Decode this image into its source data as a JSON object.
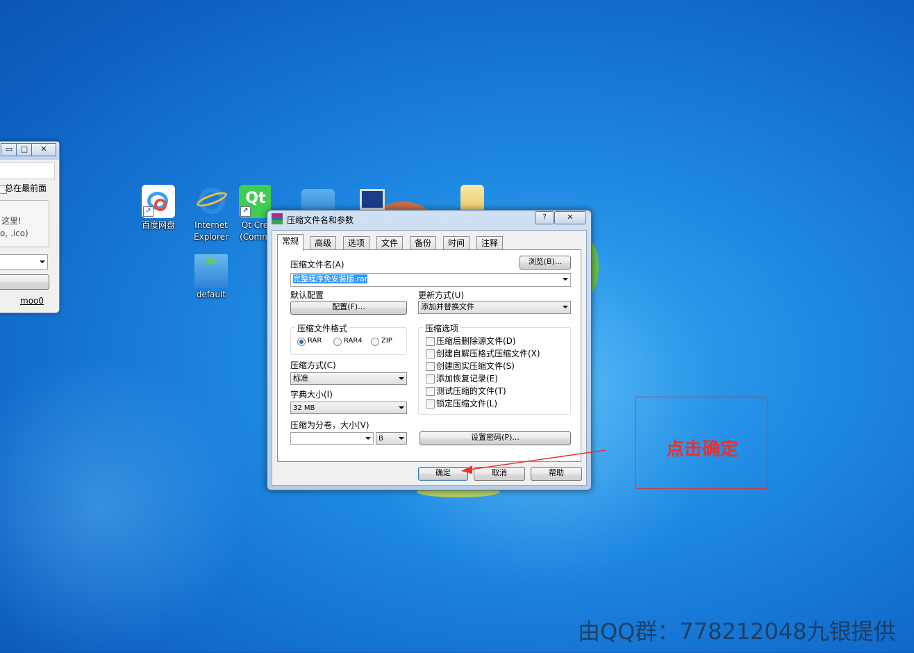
{
  "desktop": {
    "icons": [
      {
        "label": "百度网盘"
      },
      {
        "label": "Internet Explorer"
      },
      {
        "label": "Qt Cre (Comm"
      },
      {
        "label": "default"
      }
    ]
  },
  "left_window": {
    "checkbox_label": "总在最前面",
    "text_line1": "这里!",
    "text_line2": "o, .ico)",
    "link": "moo0"
  },
  "dialog": {
    "title": "压缩文件名和参数",
    "tabs": [
      "常规",
      "高级",
      "选项",
      "文件",
      "备份",
      "时间",
      "注释"
    ],
    "archive_name_label": "压缩文件名(A)",
    "browse_button": "浏览(B)...",
    "archive_name_value": "完整程序免安装版.rar",
    "default_profile_label": "默认配置",
    "profile_button": "配置(F)...",
    "update_mode_label": "更新方式(U)",
    "update_mode_value": "添加并替换文件",
    "format_group": "压缩文件格式",
    "formats": [
      "RAR",
      "RAR4",
      "ZIP"
    ],
    "method_label": "压缩方式(C)",
    "method_value": "标准",
    "dict_label": "字典大小(I)",
    "dict_value": "32 MB",
    "split_label": "压缩为分卷，大小(V)",
    "split_value": "",
    "split_unit": "B",
    "options_group": "压缩选项",
    "options": [
      "压缩后删除源文件(D)",
      "创建自解压格式压缩文件(X)",
      "创建固实压缩文件(S)",
      "添加恢复记录(E)",
      "测试压缩的文件(T)",
      "锁定压缩文件(L)"
    ],
    "password_button": "设置密码(P)...",
    "ok_button": "确定",
    "cancel_button": "取消",
    "help_button": "帮助",
    "help_caption": "?",
    "close_caption": "✕"
  },
  "annotation": {
    "text": "点击确定",
    "color": "#e8322e"
  },
  "watermark": "由QQ群：778212048九银提供"
}
